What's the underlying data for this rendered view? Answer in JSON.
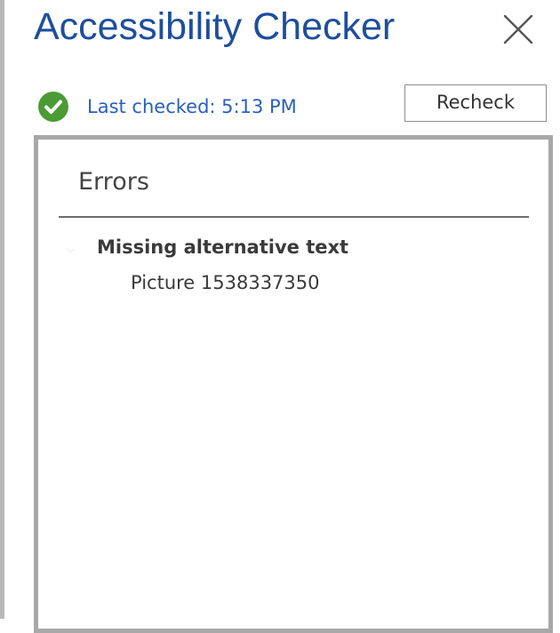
{
  "pane": {
    "title": "Accessibility Checker",
    "close_icon": "close-icon"
  },
  "status": {
    "icon": "check-circle-icon",
    "last_checked_label": "Last checked: 5:13 PM",
    "recheck_label": "Recheck"
  },
  "results": {
    "section_header": "Errors",
    "groups": [
      {
        "category": "Missing alternative text",
        "items": [
          "Picture 1538337350"
        ]
      }
    ]
  },
  "colors": {
    "title": "#1e4e9d",
    "link": "#2a5fc0",
    "success_green": "#4a9b35",
    "panel_border": "#a8a8a8"
  }
}
